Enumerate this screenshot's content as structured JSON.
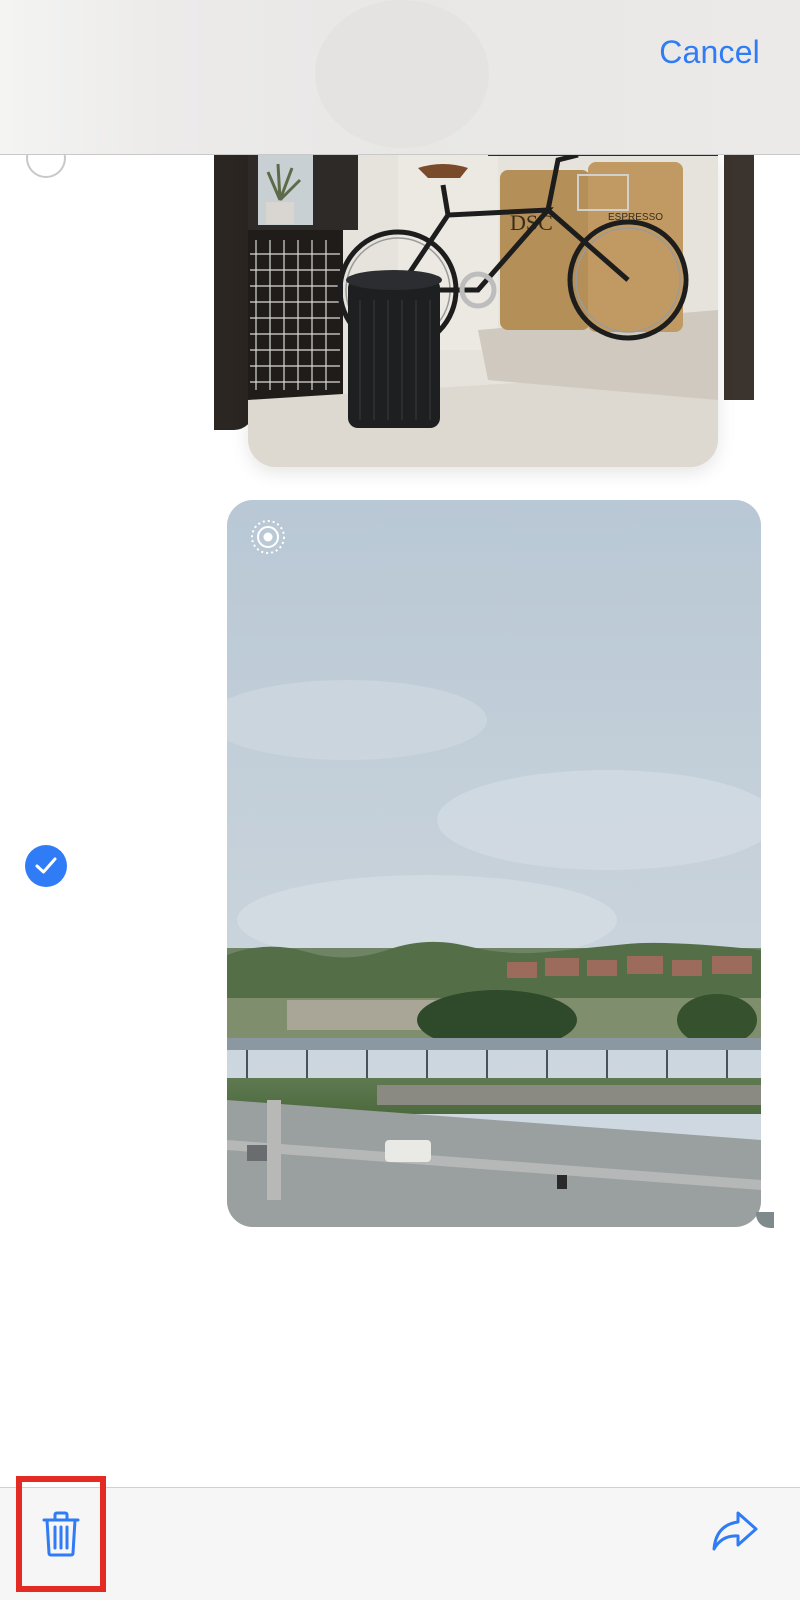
{
  "header": {
    "cancel_label": "Cancel"
  },
  "messages": [
    {
      "type": "photo",
      "subject": "bicycle-indoors",
      "selected": false
    },
    {
      "type": "live-photo",
      "subject": "cloudy-sky-landscape",
      "selected": true
    }
  ],
  "toolbar": {
    "delete_icon": "trash-icon",
    "share_icon": "share-arrow-icon",
    "delete_highlight_color": "#e32b23"
  },
  "colors": {
    "accent": "#2f7cf6",
    "unselected_circle": "#c7c7cc"
  }
}
